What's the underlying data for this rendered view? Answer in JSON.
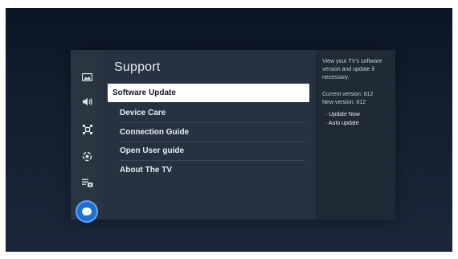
{
  "screen": {
    "title": "Support",
    "menu": [
      {
        "label": "Software Update",
        "selected": true
      },
      {
        "label": "Device Care",
        "selected": false
      },
      {
        "label": "Connection Guide",
        "selected": false
      },
      {
        "label": "Open User guide",
        "selected": false
      },
      {
        "label": "About The TV",
        "selected": false
      }
    ],
    "info": {
      "description": "View your TV's software version and update if necessary.",
      "current_version": "Current version: 812",
      "new_version": "New version: 812",
      "options": [
        "· Update Now",
        "· Auto update"
      ]
    }
  },
  "side_rail": [
    {
      "icon": "picture-icon"
    },
    {
      "icon": "sound-icon"
    },
    {
      "icon": "connection-icon"
    },
    {
      "icon": "general-icon"
    },
    {
      "icon": "accessibility-icon"
    },
    {
      "icon": "support-icon",
      "active": true
    }
  ],
  "colors": {
    "selected_bg": "#ffffff",
    "accent": "#1d6fd1",
    "panel_bg": "#26323f"
  }
}
